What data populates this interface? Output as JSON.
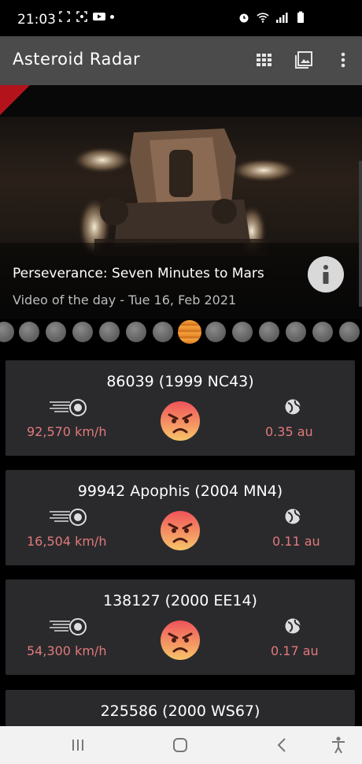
{
  "status_bar": {
    "time": "21:03"
  },
  "app_bar": {
    "title": "Asteroid Radar"
  },
  "hero": {
    "title": "Perseverance: Seven Minutes to Mars",
    "subtitle": "Video of the day - Tue 16, Feb 2021"
  },
  "carousel": {
    "total_dots": 13,
    "active_index": 7
  },
  "asteroids": [
    {
      "name": "86039 (1999 NC43)",
      "speed": "92,570 km/h",
      "distance": "0.35 au"
    },
    {
      "name": "99942 Apophis (2004 MN4)",
      "speed": "16,504 km/h",
      "distance": "0.11 au"
    },
    {
      "name": "138127 (2000 EE14)",
      "speed": "54,300 km/h",
      "distance": "0.17 au"
    },
    {
      "name": "225586 (2000 WS67)",
      "speed": "",
      "distance": ""
    }
  ],
  "colors": {
    "accent": "#b3141b",
    "value_text": "#e07a7a",
    "card": "#2a2a2d",
    "app_bar": "#4b4b4b"
  },
  "icons": {
    "hazard": "angry-face-icon",
    "speed": "comet-icon",
    "distance": "globe-icon"
  }
}
